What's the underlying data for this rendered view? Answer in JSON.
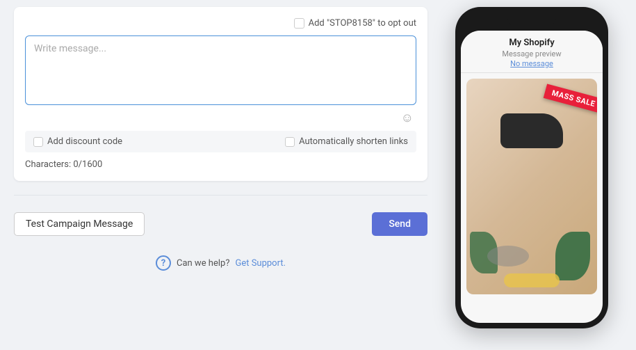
{
  "opt_out": {
    "checkbox_label": "Add \"STOP8158\" to opt out"
  },
  "message_area": {
    "placeholder": "Write message...",
    "value": ""
  },
  "options": {
    "discount_code_label": "Add discount code",
    "shorten_links_label": "Automatically shorten links"
  },
  "character_count": {
    "label": "Characters: 0/1600"
  },
  "actions": {
    "test_button_label": "Test Campaign Message",
    "send_button_label": "Send"
  },
  "help": {
    "can_we_help": "Can we help?",
    "get_support_label": "Get Support."
  },
  "phone": {
    "store_name": "My Shopify",
    "preview_label": "Message preview",
    "no_message_label": "No message",
    "sale_badge": "MASS SALE"
  }
}
